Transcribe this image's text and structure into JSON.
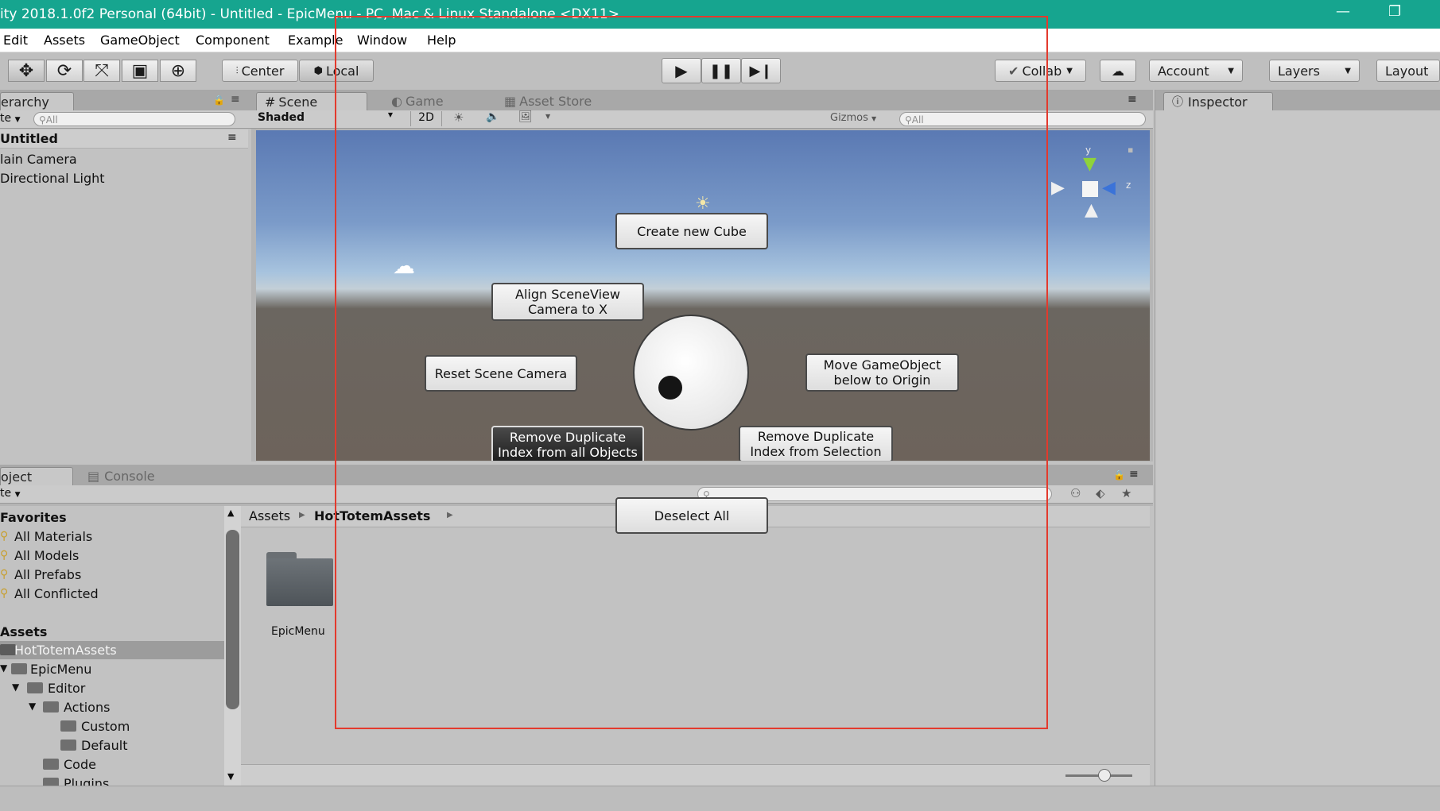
{
  "window": {
    "title": "ity 2018.1.0f2 Personal (64bit) - Untitled - EpicMenu - PC, Mac & Linux Standalone <DX11>",
    "minimize_icon": "minimize-icon",
    "restore_icon": "restore-icon"
  },
  "menubar": {
    "items": [
      "Edit",
      "Assets",
      "GameObject",
      "Component",
      "Example",
      "Window",
      "Help"
    ]
  },
  "toolbar": {
    "tools": [
      "move-icon",
      "rotate-icon",
      "scale-icon",
      "rect-icon",
      "transform-icon"
    ],
    "pivot_label": "Center",
    "space_label": "Local",
    "collab_label": "Collab",
    "account_label": "Account",
    "layers_label": "Layers",
    "layout_label": "Layout"
  },
  "hierarchy": {
    "tab_label": "erarchy",
    "create_label": "te",
    "search_placeholder": "All",
    "scene_name": "Untitled",
    "items": [
      "lain Camera",
      "Directional Light"
    ]
  },
  "scene_view": {
    "tabs": [
      "Scene",
      "Game",
      "Asset Store"
    ],
    "shading": "Shaded",
    "mode_2d": "2D",
    "gizmos_label": "Gizmos",
    "search_placeholder": "All",
    "axis_labels": [
      "y",
      "z"
    ]
  },
  "inspector": {
    "tab_label": "Inspector"
  },
  "epic_menu": {
    "create_cube": "Create new Cube",
    "align_camera": "Align SceneView Camera to X",
    "reset_camera": "Reset Scene Camera",
    "move_origin": "Move GameObject below to Origin",
    "remove_dup_all": "Remove Duplicate Index from all Objects",
    "remove_dup_sel": "Remove Duplicate Index from Selection",
    "deselect_all": "Deselect All"
  },
  "project": {
    "tabs": [
      "oject",
      "Console"
    ],
    "create_label": "te",
    "favorites_header": "Favorites",
    "favorites": [
      "All Materials",
      "All Models",
      "All Prefabs",
      "All Conflicted"
    ],
    "assets_header": "Assets",
    "tree": [
      "HotTotemAssets",
      "EpicMenu",
      "Editor",
      "Actions",
      "Custom",
      "Default",
      "Code",
      "Plugins"
    ],
    "breadcrumb": [
      "Assets",
      "HotTotemAssets"
    ],
    "folder_name": "EpicMenu"
  },
  "colors": {
    "title_bar": "#16a58f",
    "highlight": "#e33a2d",
    "selected_row": "#9c9c9c"
  }
}
